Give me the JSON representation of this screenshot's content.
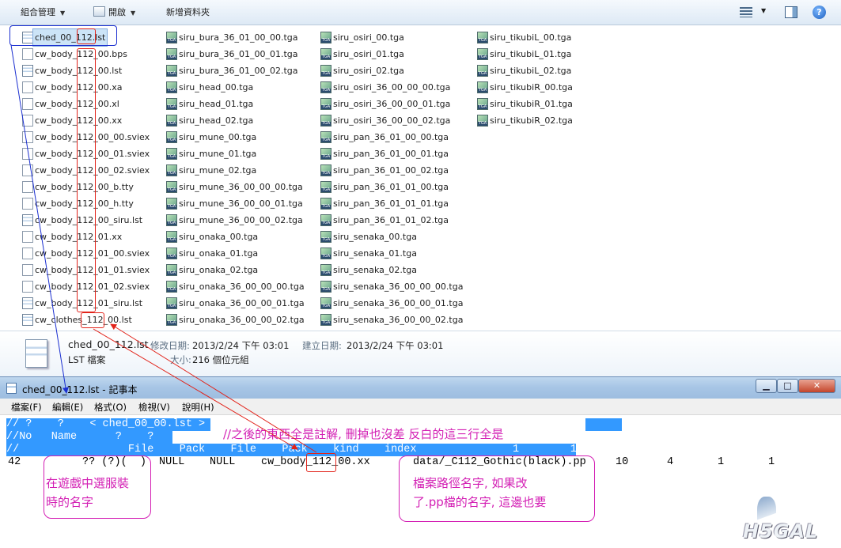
{
  "explorer": {
    "toolbar": {
      "organize": "組合管理",
      "open": "開啟",
      "new_folder": "新增資料夾"
    },
    "columns": [
      [
        "ched_00_112.lst",
        "cw_body_112_00.bps",
        "cw_body_112_00.lst",
        "cw_body_112_00.xa",
        "cw_body_112_00.xl",
        "cw_body_112_00.xx",
        "cw_body_112_00_00.sviex",
        "cw_body_112_00_01.sviex",
        "cw_body_112_00_02.sviex",
        "cw_body_112_00_b.tty",
        "cw_body_112_00_h.tty",
        "cw_body_112_00_siru.lst",
        "cw_body_112_01.xx",
        "cw_body_112_01_00.sviex",
        "cw_body_112_01_01.sviex",
        "cw_body_112_01_02.sviex",
        "cw_body_112_01_siru.lst",
        "cw_clothes_112_00.lst"
      ],
      [
        "siru_bura_36_01_00_00.tga",
        "siru_bura_36_01_00_01.tga",
        "siru_bura_36_01_00_02.tga",
        "siru_head_00.tga",
        "siru_head_01.tga",
        "siru_head_02.tga",
        "siru_mune_00.tga",
        "siru_mune_01.tga",
        "siru_mune_02.tga",
        "siru_mune_36_00_00_00.tga",
        "siru_mune_36_00_00_01.tga",
        "siru_mune_36_00_00_02.tga",
        "siru_onaka_00.tga",
        "siru_onaka_01.tga",
        "siru_onaka_02.tga",
        "siru_onaka_36_00_00_00.tga",
        "siru_onaka_36_00_00_01.tga",
        "siru_onaka_36_00_00_02.tga"
      ],
      [
        "siru_osiri_00.tga",
        "siru_osiri_01.tga",
        "siru_osiri_02.tga",
        "siru_osiri_36_00_00_00.tga",
        "siru_osiri_36_00_00_01.tga",
        "siru_osiri_36_00_00_02.tga",
        "siru_pan_36_01_00_00.tga",
        "siru_pan_36_01_00_01.tga",
        "siru_pan_36_01_00_02.tga",
        "siru_pan_36_01_01_00.tga",
        "siru_pan_36_01_01_01.tga",
        "siru_pan_36_01_01_02.tga",
        "siru_senaka_00.tga",
        "siru_senaka_01.tga",
        "siru_senaka_02.tga",
        "siru_senaka_36_00_00_00.tga",
        "siru_senaka_36_00_00_01.tga",
        "siru_senaka_36_00_00_02.tga"
      ],
      [
        "siru_tikubiL_00.tga",
        "siru_tikubiL_01.tga",
        "siru_tikubiL_02.tga",
        "siru_tikubiR_00.tga",
        "siru_tikubiR_01.tga",
        "siru_tikubiR_02.tga"
      ]
    ],
    "details": {
      "filename": "ched_00_112.lst",
      "type": "LST 檔案",
      "modified_label": "修改日期:",
      "modified_value": "2013/2/24 下午 03:01",
      "created_label": "建立日期:",
      "created_value": "2013/2/24 下午 03:01",
      "size_label": "大小:",
      "size_value": "216 個位元組"
    }
  },
  "notepad": {
    "title": "ched_00_112.lst - 記事本",
    "window_buttons": {
      "minimize": "▁",
      "maximize": "□",
      "close": "✕"
    },
    "menu": [
      "檔案(F)",
      "編輯(E)",
      "格式(O)",
      "檢視(V)",
      "說明(H)"
    ],
    "lines": [
      "// ?    ?    < ched_00_00.lst >",
      "//No   Name      ?    ?",
      "//                 File    Pack    File    Pack    kind    index               1        1"
    ],
    "data_line": {
      "num": "42",
      "name": "?? (?)(  )",
      "c1": "NULL",
      "c2": "NULL",
      "file_pre": "cw_body_",
      "file_hl": "112",
      "file_post": "_00.xx",
      "path": "data/_C112_Gothic(black).pp",
      "v1": "10",
      "v2": "4",
      "v3": "1",
      "v4": "1"
    }
  },
  "annotations": {
    "comment_note": "//之後的東西全是註解, 刪掉也沒差 反白的這三行全是",
    "name_note_1": "在遊戲中選服裝",
    "name_note_2": "時的名字",
    "path_note_1": "檔案路徑名字, 如果改",
    "path_note_2": "了.pp檔的名字, 這邊也要"
  },
  "watermark": "H5GAL",
  "colors": {
    "annotation": "#d31fb4",
    "highlight": "#3399ff",
    "red_box": "#e2231a",
    "blue_line": "#1b2fd0"
  }
}
